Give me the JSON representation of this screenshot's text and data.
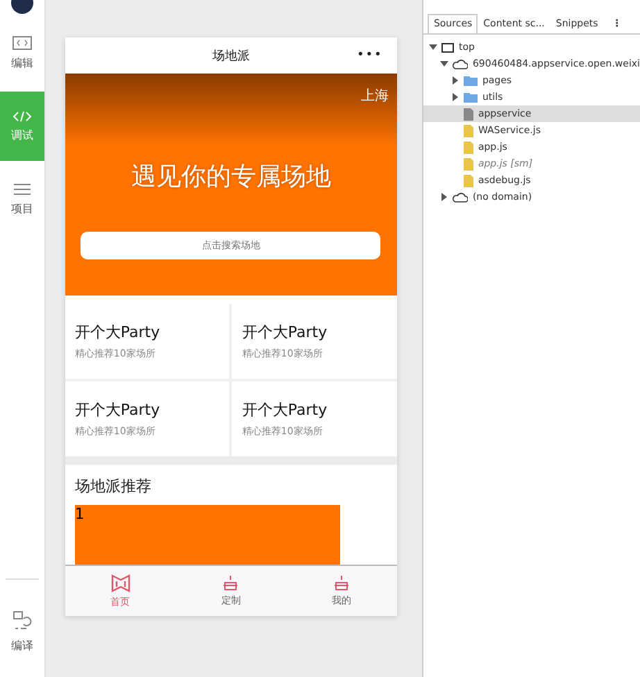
{
  "sidebar": {
    "items": [
      {
        "kind": "code",
        "label": "编辑",
        "selected": false
      },
      {
        "kind": "debug",
        "label": "调试",
        "selected": true
      },
      {
        "kind": "menu",
        "label": "项目",
        "selected": false
      }
    ],
    "bottom_item": {
      "label": "编译"
    }
  },
  "phone": {
    "nav": {
      "title": "场地派",
      "more": "•••"
    },
    "banner": {
      "city": "上海",
      "headline": "遇见你的专属场地",
      "search_placeholder": "点击搜索场地"
    },
    "cards": [
      {
        "title": "开个大Party",
        "subtitle": "精心推荐10家场所"
      },
      {
        "title": "开个大Party",
        "subtitle": "精心推荐10家场所"
      },
      {
        "title": "开个大Party",
        "subtitle": "精心推荐10家场所"
      },
      {
        "title": "开个大Party",
        "subtitle": "精心推荐10家场所"
      }
    ],
    "recommend": {
      "title": "场地派推荐",
      "slides": [
        {
          "label": "1"
        }
      ]
    },
    "tabs": [
      {
        "kind": "home",
        "label": "首页",
        "selected": true
      },
      {
        "kind": "cake",
        "label": "定制",
        "selected": false
      },
      {
        "kind": "cake",
        "label": "我的",
        "selected": false
      }
    ]
  },
  "devtools": {
    "tabs": [
      {
        "label": "Sources",
        "selected": true
      },
      {
        "label": "Content sc...",
        "selected": false
      },
      {
        "label": "Snippets",
        "selected": false
      }
    ],
    "more": "⋮",
    "tree": [
      {
        "kind": "frame",
        "label": "top",
        "expanded": true,
        "children": [
          {
            "kind": "cloud",
            "label": "690460484.appservice.open.weixi",
            "expanded": true,
            "children": [
              {
                "kind": "folder",
                "label": "pages",
                "expanded": false
              },
              {
                "kind": "folder",
                "label": "utils",
                "expanded": false
              },
              {
                "kind": "file",
                "label": "appservice",
                "selected": true
              },
              {
                "kind": "file",
                "label": "WAService.js",
                "selected": false
              },
              {
                "kind": "file",
                "label": "app.js",
                "selected": false
              },
              {
                "kind": "file",
                "label": "app.js [sm]",
                "selected": false,
                "italic": true
              },
              {
                "kind": "file",
                "label": "asdebug.js",
                "selected": false
              }
            ]
          },
          {
            "kind": "cloud",
            "label": "(no domain)",
            "expanded": false
          }
        ]
      }
    ]
  }
}
